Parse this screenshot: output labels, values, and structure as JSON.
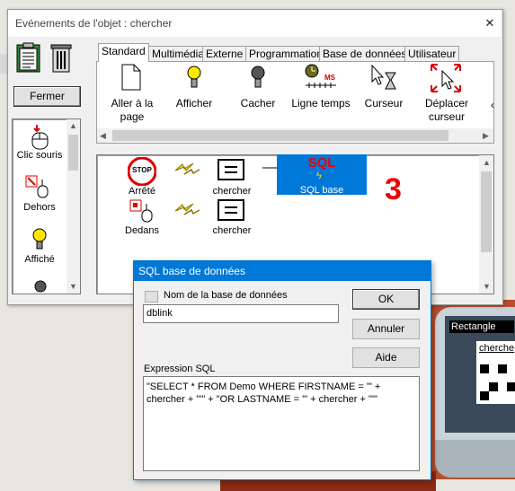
{
  "main_window": {
    "title": "Evénements de l'objet : chercher",
    "close_button": "✕",
    "fermer_label": "Fermer"
  },
  "tabs": [
    "Standard",
    "Multimédia",
    "Externe",
    "Programmation",
    "Base de données",
    "Utilisateur"
  ],
  "toolbar": {
    "items": [
      {
        "label_line1": "Aller à la",
        "label_line2": "page"
      },
      {
        "label_line1": "Afficher",
        "label_line2": ""
      },
      {
        "label_line1": "Cacher",
        "label_line2": ""
      },
      {
        "label_line1": "Ligne temps",
        "label_line2": ""
      },
      {
        "label_line1": "Curseur",
        "label_line2": ""
      },
      {
        "label_line1": "Déplacer",
        "label_line2": "curseur"
      }
    ],
    "timeline_icon_text": "MS"
  },
  "event_list": {
    "items": [
      "Clic souris",
      "Dehors",
      "Affiché"
    ]
  },
  "script_area": {
    "row1": {
      "event": "Arrêté",
      "stop_text": "STOP",
      "object": "chercher",
      "action_title": "SQL",
      "action_label": "SQL base"
    },
    "row2": {
      "event": "Dedans",
      "object": "chercher"
    },
    "annotation": "3"
  },
  "sql_dialog": {
    "title": "SQL base de données",
    "db_checkbox_label": "Nom de la base de données",
    "db_value": "dblink",
    "ok_label": "OK",
    "cancel_label": "Annuler",
    "help_label": "Aide",
    "expression_label": "Expression SQL",
    "expression_value": "\"SELECT * FROM Demo WHERE FIRSTNAME = '\" + chercher + \"'\" + \"OR LASTNAME = '\" + chercher + \"'\""
  },
  "background_app": {
    "rectangle_label": "Rectangle",
    "chercher_label": "cherche"
  }
}
